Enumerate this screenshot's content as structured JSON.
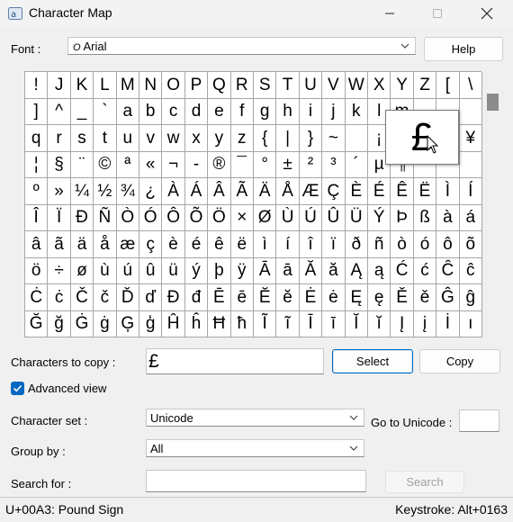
{
  "window": {
    "title": "Character Map",
    "min_glyph": "—",
    "max_glyph": "☐",
    "close_glyph": "✕"
  },
  "font": {
    "label": "Font :",
    "value": "Arial",
    "value_icon": "O",
    "help_label": "Help"
  },
  "grid": {
    "columns": 20,
    "characters": [
      "!",
      "J",
      "K",
      "L",
      "M",
      "N",
      "O",
      "P",
      "Q",
      "R",
      "S",
      "T",
      "U",
      "V",
      "W",
      "X",
      "Y",
      "Z",
      "[",
      "\\",
      "]",
      "^",
      "_",
      "`",
      "a",
      "b",
      "c",
      "d",
      "e",
      "f",
      "g",
      "h",
      "i",
      "j",
      "k",
      "l",
      "m",
      "",
      "",
      "",
      "q",
      "r",
      "s",
      "t",
      "u",
      "v",
      "w",
      "x",
      "y",
      "z",
      "{",
      "|",
      "}",
      "~",
      "",
      "¡",
      "",
      "",
      "",
      "¥",
      "¦",
      "§",
      "¨",
      "©",
      "ª",
      "«",
      "¬",
      "-",
      "®",
      "¯",
      "°",
      "±",
      "²",
      "³",
      "´",
      "µ",
      "¶",
      "",
      "",
      "",
      "º",
      "»",
      "¼",
      "½",
      "¾",
      "¿",
      "À",
      "Á",
      "Â",
      "Ã",
      "Ä",
      "Å",
      "Æ",
      "Ç",
      "È",
      "É",
      "Ê",
      "Ë",
      "Ì",
      "Í",
      "Î",
      "Ï",
      "Ð",
      "Ñ",
      "Ò",
      "Ó",
      "Ô",
      "Õ",
      "Ö",
      "×",
      "Ø",
      "Ù",
      "Ú",
      "Û",
      "Ü",
      "Ý",
      "Þ",
      "ß",
      "à",
      "á",
      "â",
      "ã",
      "ä",
      "å",
      "æ",
      "ç",
      "è",
      "é",
      "ê",
      "ë",
      "ì",
      "í",
      "î",
      "ï",
      "ð",
      "ñ",
      "ò",
      "ó",
      "ô",
      "õ",
      "ö",
      "÷",
      "ø",
      "ù",
      "ú",
      "û",
      "ü",
      "ý",
      "þ",
      "ÿ",
      "Ā",
      "ā",
      "Ă",
      "ă",
      "Ą",
      "ą",
      "Ć",
      "ć",
      "Ĉ",
      "ĉ",
      "Ċ",
      "ċ",
      "Č",
      "č",
      "Ď",
      "ď",
      "Đ",
      "đ",
      "Ē",
      "ē",
      "Ĕ",
      "ĕ",
      "Ė",
      "ė",
      "Ę",
      "ę",
      "Ě",
      "ě",
      "Ĝ",
      "ĝ",
      "Ğ",
      "ğ",
      "Ġ",
      "ġ",
      "Ģ",
      "ģ",
      "Ĥ",
      "ĥ",
      "Ħ",
      "ħ",
      "Ĩ",
      "ĩ",
      "Ī",
      "ī",
      "Ĭ",
      "ĭ",
      "Į",
      "į",
      "İ",
      "ı"
    ],
    "zoom_char": "£"
  },
  "copy": {
    "label": "Characters to copy :",
    "value": "£",
    "select_label": "Select",
    "copy_label": "Copy"
  },
  "advanced": {
    "label": "Advanced view",
    "checked": true
  },
  "charset": {
    "label": "Character set :",
    "value": "Unicode",
    "goto_label": "Go to Unicode :",
    "goto_value": ""
  },
  "groupby": {
    "label": "Group by :",
    "value": "All"
  },
  "search": {
    "label": "Search for :",
    "value": "",
    "button_label": "Search"
  },
  "status": {
    "left": "U+00A3: Pound Sign",
    "right": "Keystroke: Alt+0163"
  },
  "colors": {
    "accent": "#0067c0",
    "grid_line": "#a6a6a6",
    "background": "#f0f0f0"
  },
  "icons": {
    "app": "character-map-icon",
    "dropdown": "chevron-down-icon",
    "check": "checkmark-icon",
    "cursor": "mouse-pointer-icon"
  }
}
